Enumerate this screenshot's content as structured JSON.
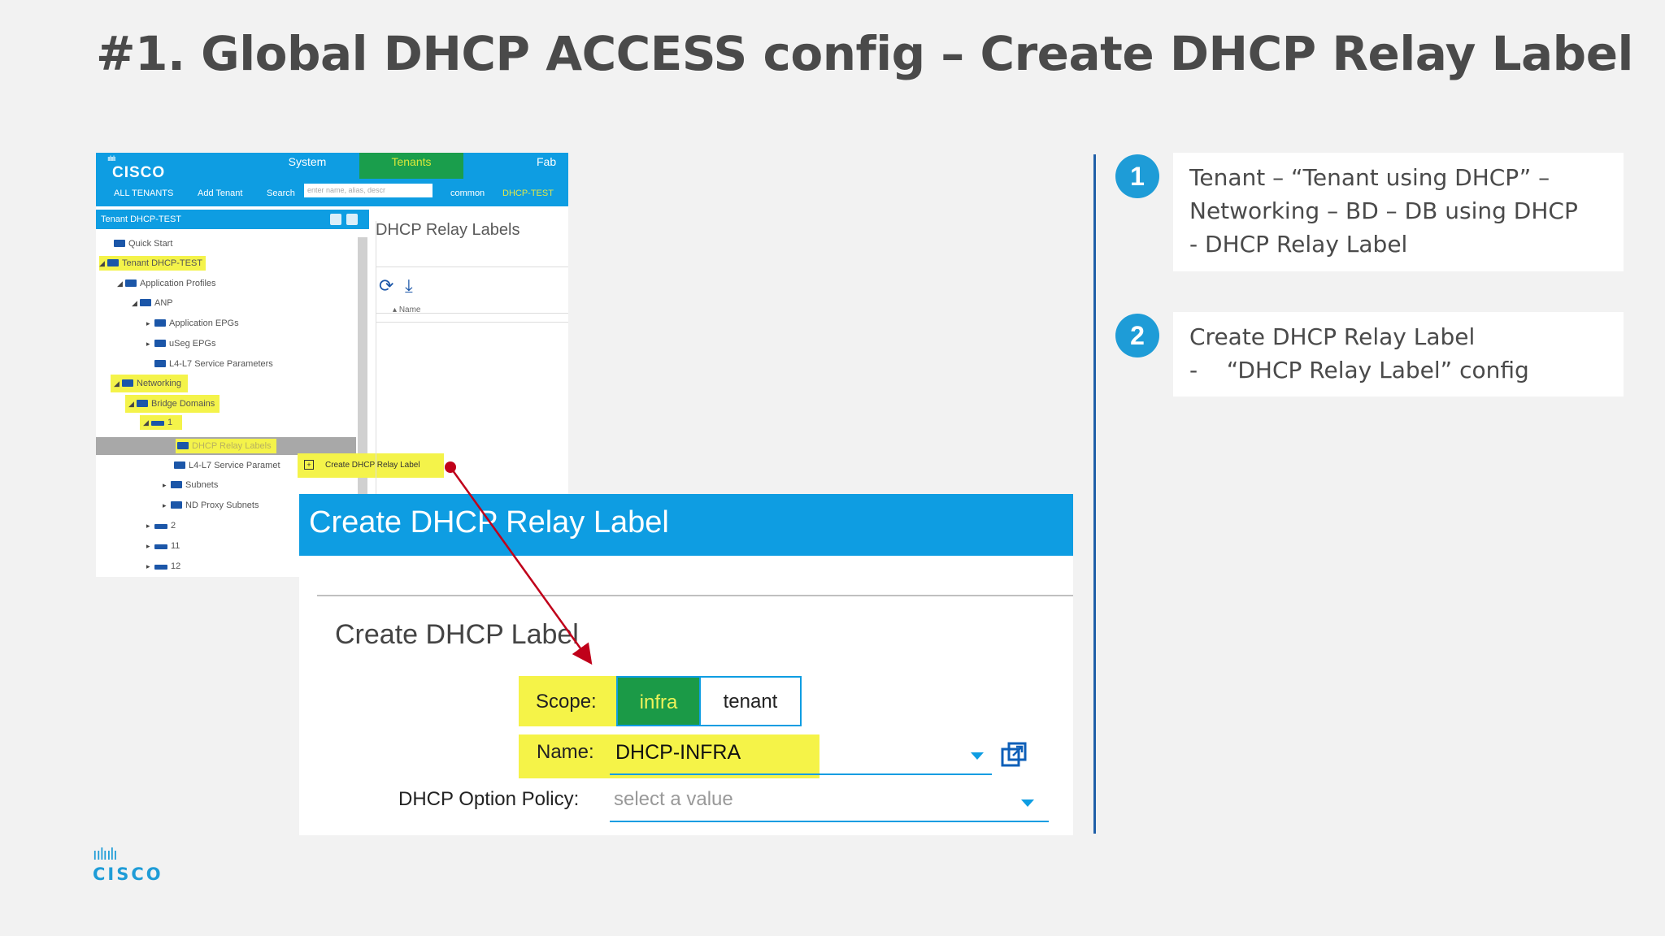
{
  "slide": {
    "title": "#1. Global DHCP ACCESS config – Create DHCP Relay Label"
  },
  "apic": {
    "logo_bars": "ıılıılı",
    "logo_word": "CISCO",
    "top_tabs": [
      "System",
      "Tenants",
      "Fab"
    ],
    "subnav": {
      "all_tenants": "ALL TENANTS",
      "add_tenant": "Add Tenant",
      "search_label": "Search",
      "search_placeholder": "enter name, alias, descr",
      "common": "common",
      "dhcp_test": "DHCP-TEST"
    },
    "tree_header": "Tenant DHCP-TEST",
    "tree": [
      {
        "label": "Quick Start"
      },
      {
        "label": "Tenant DHCP-TEST"
      },
      {
        "label": "Application Profiles"
      },
      {
        "label": "ANP"
      },
      {
        "label": "Application EPGs"
      },
      {
        "label": "uSeg EPGs"
      },
      {
        "label": "L4-L7 Service Parameters"
      },
      {
        "label": "Networking"
      },
      {
        "label": "Bridge Domains"
      },
      {
        "label": "1"
      },
      {
        "label": "DHCP Relay Labels"
      },
      {
        "label": "L4-L7 Service Paramet"
      },
      {
        "label": "Subnets"
      },
      {
        "label": "ND Proxy Subnets"
      },
      {
        "label": "2"
      },
      {
        "label": "11"
      },
      {
        "label": "12"
      }
    ],
    "context_menu": "Create DHCP Relay Label",
    "relay_panel": {
      "title": "DHCP Relay Labels",
      "column": "Name"
    }
  },
  "dialog": {
    "title": "Create DHCP Relay Label",
    "section": "Create DHCP Label",
    "scope_label": "Scope:",
    "scope_options": [
      "infra",
      "tenant"
    ],
    "scope_selected": "infra",
    "name_label": "Name:",
    "name_value": "DHCP-INFRA",
    "option_policy_label": "DHCP Option Policy:",
    "option_policy_placeholder": "select a value"
  },
  "steps": [
    {
      "number": "1",
      "lines": [
        "Tenant – “Tenant using DHCP” –",
        "Networking – BD – DB using DHCP",
        "- DHCP Relay Label"
      ]
    },
    {
      "number": "2",
      "lines": [
        "Create DHCP Relay Label",
        "-    “DHCP Relay Label” config"
      ]
    }
  ],
  "footer": {
    "logo_bars": "ıılıılı",
    "logo_word": "CISCO"
  },
  "colors": {
    "accent_blue": "#0e9de2",
    "highlight_yellow": "#f5f348",
    "selected_green": "#1b9a47",
    "arrow_red": "#c0001a",
    "divider_navy": "#1f5fa8"
  }
}
